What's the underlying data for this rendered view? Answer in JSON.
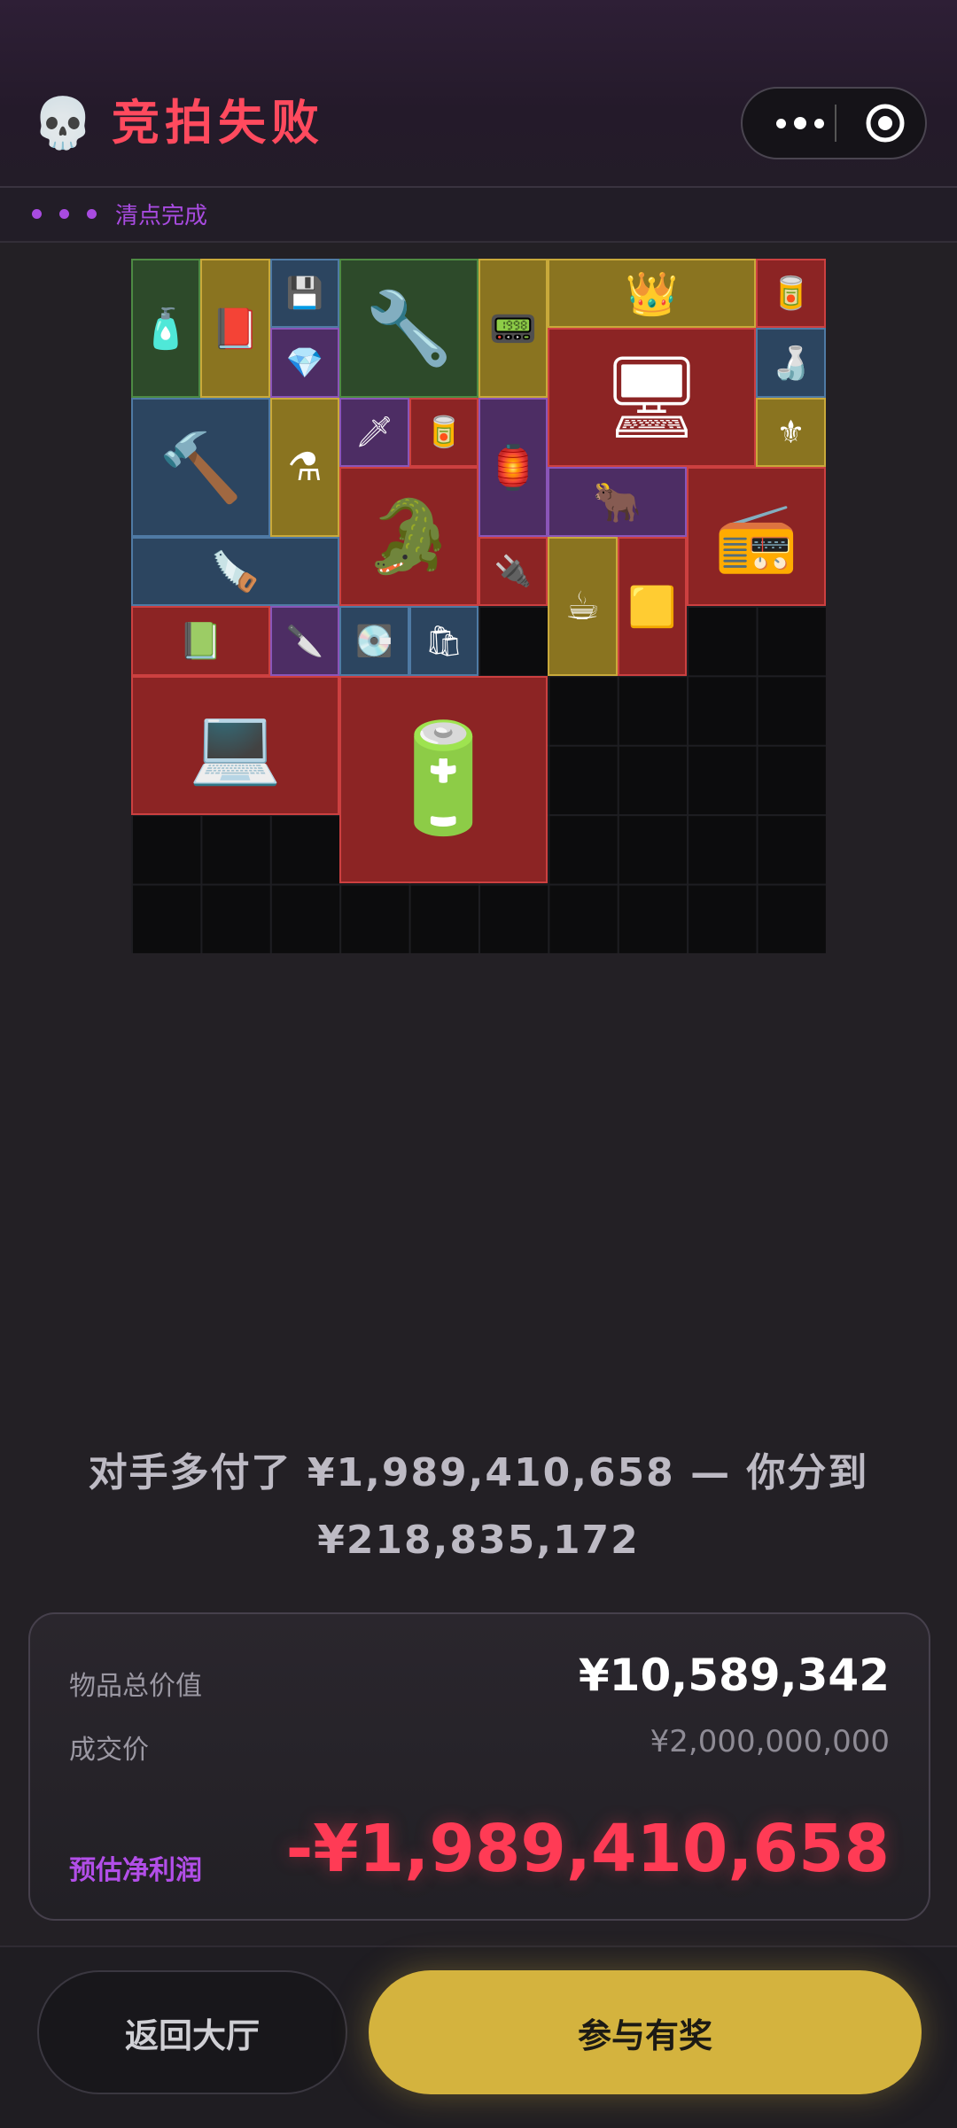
{
  "header": {
    "icon": "skull-icon",
    "title": "竞拍失败",
    "menu_icon": "more-dots-icon",
    "close_icon": "target-icon"
  },
  "status": {
    "text": "清点完成"
  },
  "inventory": {
    "items": [
      {
        "name": "spray-can",
        "rarity": "green",
        "glyph": "🧴"
      },
      {
        "name": "book",
        "rarity": "gold",
        "glyph": "📕"
      },
      {
        "name": "usb-drive",
        "rarity": "blue",
        "glyph": "💾"
      },
      {
        "name": "angle-grinder",
        "rarity": "green",
        "glyph": "🔧"
      },
      {
        "name": "data-card",
        "rarity": "gold",
        "glyph": "📟"
      },
      {
        "name": "gold-crown",
        "rarity": "gold",
        "glyph": "👑"
      },
      {
        "name": "tin-can",
        "rarity": "red",
        "glyph": "🥫"
      },
      {
        "name": "earring",
        "rarity": "purple",
        "glyph": "💎"
      },
      {
        "name": "server-unit",
        "rarity": "red",
        "glyph": "🖥"
      },
      {
        "name": "water-bottle",
        "rarity": "blue",
        "glyph": "🍶"
      },
      {
        "name": "rotary-hammer",
        "rarity": "blue",
        "glyph": "🔨"
      },
      {
        "name": "blue-potion",
        "rarity": "gold",
        "glyph": "⚗"
      },
      {
        "name": "arrowhead",
        "rarity": "purple",
        "glyph": "🗡"
      },
      {
        "name": "tin-can-2",
        "rarity": "red",
        "glyph": "🥫"
      },
      {
        "name": "lantern",
        "rarity": "purple",
        "glyph": "🏮"
      },
      {
        "name": "emblem",
        "rarity": "gold",
        "glyph": "⚜"
      },
      {
        "name": "gold-crocodile",
        "rarity": "red",
        "glyph": "🐊"
      },
      {
        "name": "horned-amulet",
        "rarity": "purple",
        "glyph": "🐂"
      },
      {
        "name": "radio",
        "rarity": "red",
        "glyph": "📻"
      },
      {
        "name": "saw",
        "rarity": "blue",
        "glyph": "🪚"
      },
      {
        "name": "flash-drive",
        "rarity": "red",
        "glyph": "🔌"
      },
      {
        "name": "coffee-box",
        "rarity": "gold",
        "glyph": "☕"
      },
      {
        "name": "gold-bar",
        "rarity": "red",
        "glyph": "🟨"
      },
      {
        "name": "green-tablet",
        "rarity": "red",
        "glyph": "📗"
      },
      {
        "name": "knife",
        "rarity": "purple",
        "glyph": "🔪"
      },
      {
        "name": "ssd",
        "rarity": "blue",
        "glyph": "💽"
      },
      {
        "name": "coffee-bag",
        "rarity": "blue",
        "glyph": "🛍"
      },
      {
        "name": "rugged-laptop",
        "rarity": "red",
        "glyph": "💻"
      },
      {
        "name": "reactor-core",
        "rarity": "red",
        "glyph": "🔋"
      }
    ]
  },
  "summary": {
    "line1": "对手多付了 ¥1,989,410,658 — 你分到",
    "line2": "¥218,835,172"
  },
  "result": {
    "total_value_label": "物品总价值",
    "total_value": "¥10,589,342",
    "deal_price_label": "成交价",
    "deal_price": "¥2,000,000,000",
    "net_profit_label": "预估净利润",
    "net_profit": "-¥1,989,410,658"
  },
  "buttons": {
    "back": "返回大厅",
    "prize": "参与有奖"
  },
  "colors": {
    "title_red": "#ff4a5e",
    "profit_red": "#ff3b55",
    "accent_purple": "#a84be0",
    "prize_gold": "#d4b33e"
  }
}
